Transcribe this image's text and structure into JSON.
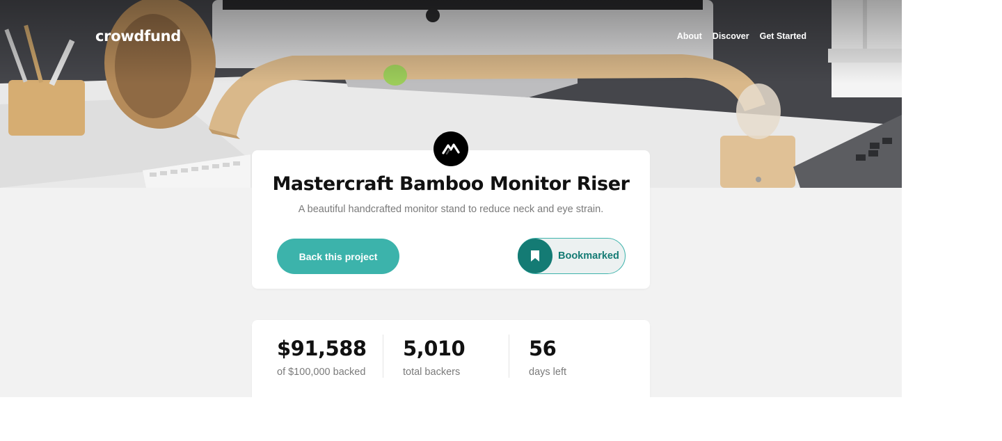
{
  "header": {
    "logo": "crowdfund",
    "nav": [
      "About",
      "Discover",
      "Get Started"
    ]
  },
  "project": {
    "title": "Mastercraft Bamboo Monitor Riser",
    "description": "A beautiful handcrafted monitor stand to reduce neck and eye strain.",
    "back_button": "Back this project",
    "bookmark_button": "Bookmarked"
  },
  "stats": [
    {
      "value": "$91,588",
      "label": "of $100,000 backed"
    },
    {
      "value": "5,010",
      "label": "total backers"
    },
    {
      "value": "56",
      "label": "days left"
    }
  ],
  "colors": {
    "accent": "#3cb3ab",
    "accent_dark": "#147b74",
    "background": "#f2f2f2"
  },
  "icons": {
    "brand": "mastercraft-logo-icon",
    "bookmark": "bookmark-icon"
  }
}
